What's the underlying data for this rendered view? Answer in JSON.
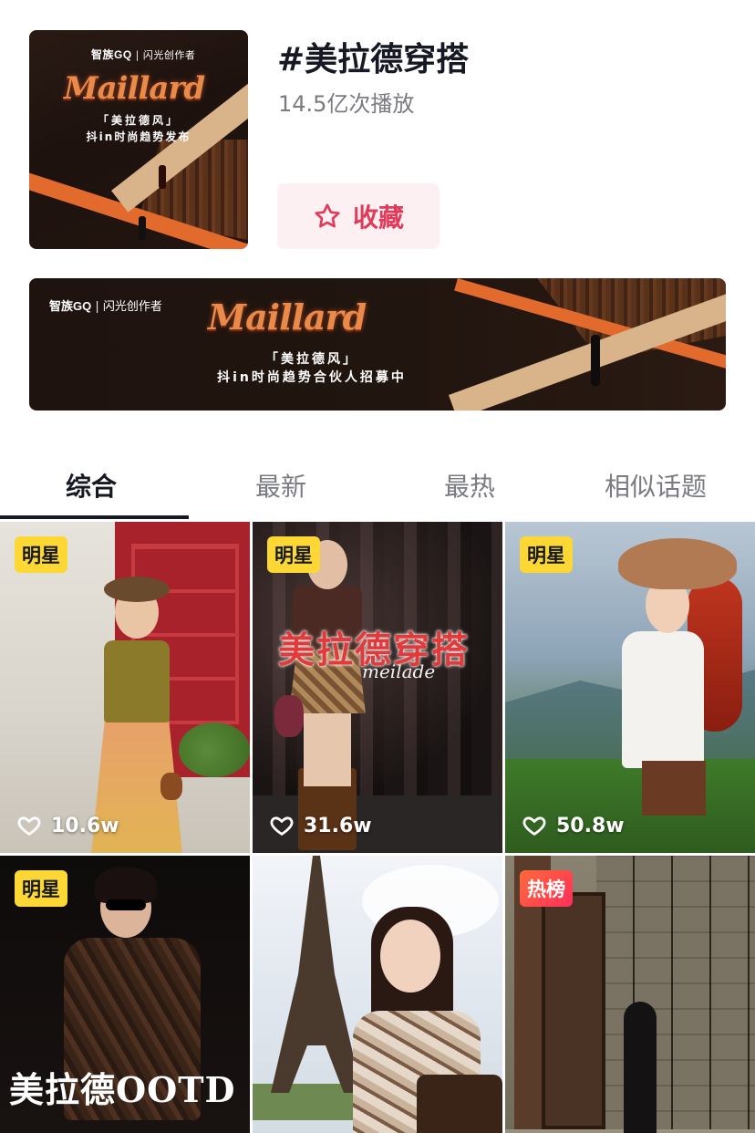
{
  "header": {
    "title": "#美拉德穿搭",
    "plays": "14.5亿次播放",
    "favorite_label": "收藏",
    "accent_color": "#e23a5b"
  },
  "cover": {
    "brand": "智族GQ",
    "partner": "闪光创作者",
    "script": "Maillard",
    "sub1": "「美拉德风」",
    "sub2": "抖in时尚趋势发布"
  },
  "banner": {
    "brand": "智族GQ",
    "partner": "闪光创作者",
    "script": "Maillard",
    "sub1": "「美拉德风」",
    "sub2": "抖in时尚趋势合伙人招募中"
  },
  "tabs": [
    {
      "label": "综合",
      "active": true
    },
    {
      "label": "最新",
      "active": false
    },
    {
      "label": "最热",
      "active": false
    },
    {
      "label": "相似话题",
      "active": false
    }
  ],
  "videos": [
    {
      "badge": "明星",
      "likes": "10.6w",
      "overlay": ""
    },
    {
      "badge": "明星",
      "likes": "31.6w",
      "overlay": "美拉德穿搭",
      "overlay_sub": "meilade"
    },
    {
      "badge": "明星",
      "likes": "50.8w",
      "overlay": ""
    },
    {
      "badge": "明星",
      "likes": "",
      "overlay": "美拉德OOTD"
    },
    {
      "badge": "",
      "likes": "",
      "overlay": ""
    },
    {
      "badge": "热榜",
      "likes": "",
      "overlay": ""
    }
  ],
  "icons": {
    "favorite": "star-outline-icon",
    "like": "heart-outline-icon"
  }
}
